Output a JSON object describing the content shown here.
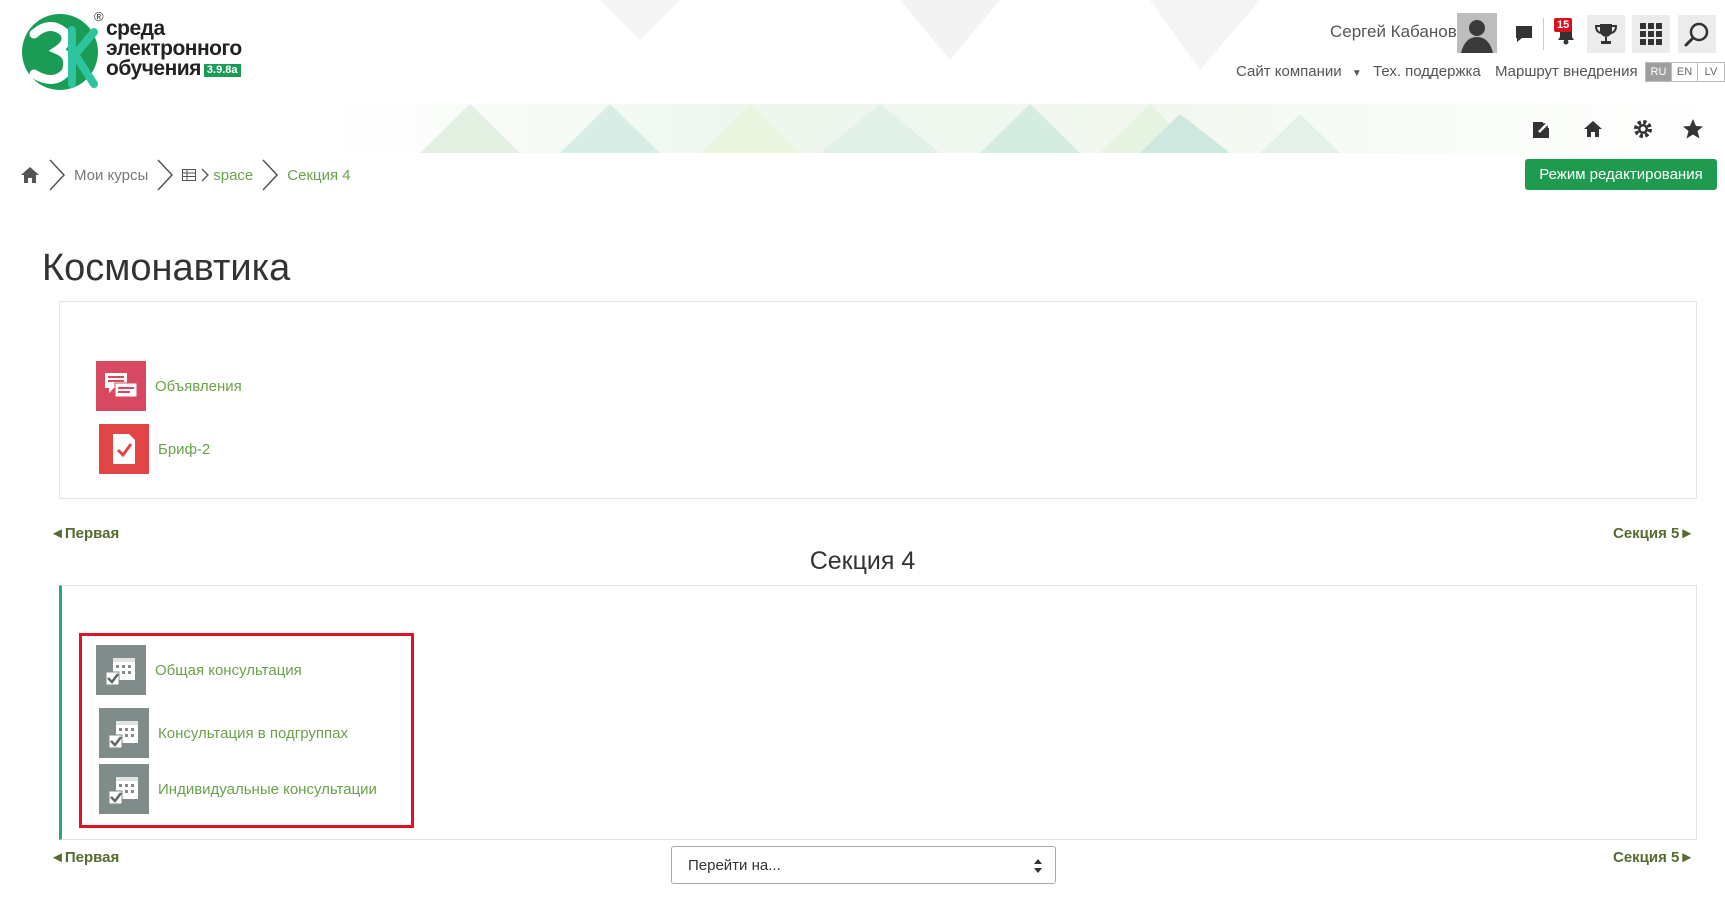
{
  "header": {
    "logo": {
      "line1": "среда",
      "line2": "электронного",
      "line3": "обучения",
      "version": "3.9.8a",
      "reg_mark": "®"
    },
    "user_name": "Сергей Кабанов",
    "notifications_count": "15",
    "nav": {
      "company_site": "Сайт компании",
      "support": "Тех. поддержка",
      "roadmap": "Маршрут внедрения"
    },
    "languages": [
      {
        "code": "RU",
        "active": true
      },
      {
        "code": "EN",
        "active": false
      },
      {
        "code": "LV",
        "active": false
      }
    ],
    "icons": {
      "messages": "chat-icon",
      "notifications": "bell-icon",
      "achievements": "trophy-icon",
      "apps": "grid-icon",
      "search": "search-icon",
      "sub": [
        "external-link-icon",
        "home-icon",
        "gear-icon",
        "star-icon"
      ]
    }
  },
  "breadcrumb": {
    "items": [
      "Мои курсы",
      "space",
      "Секция 4"
    ]
  },
  "edit_button": "Режим редактирования",
  "course_title": "Космонавтика",
  "top_section": {
    "activities": [
      {
        "label": "Объявления",
        "icon": "forum-icon",
        "color": "#d64961"
      },
      {
        "label": "Бриф-2",
        "icon": "assignment-icon",
        "color": "#e24545"
      }
    ]
  },
  "nav_prev": "◄Первая",
  "nav_next": "Секция 5►",
  "section": {
    "title": "Секция 4",
    "activities": [
      {
        "label": "Общая консультация",
        "icon": "scheduler-icon"
      },
      {
        "label": "Консультация в подгруппах",
        "icon": "scheduler-icon"
      },
      {
        "label": "Индивидуальные консультации",
        "icon": "scheduler-icon"
      }
    ]
  },
  "jump_select": {
    "placeholder": "Перейти на..."
  },
  "colors": {
    "accent_green": "#1e9b4e",
    "link_green": "#6aa24a",
    "highlight_red": "#e11320",
    "section_border": "#2aa779"
  }
}
